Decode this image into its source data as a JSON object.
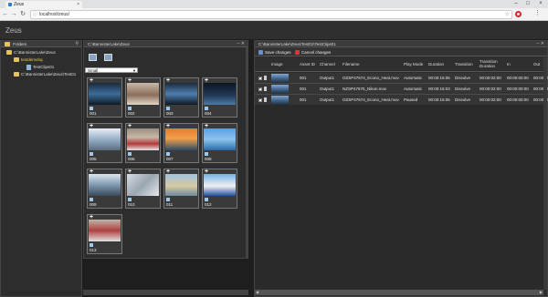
{
  "browser": {
    "tab_title": "Zeus",
    "tab_close": "×",
    "url": "localhost/zeus/",
    "window_minimize": "–",
    "window_maximize": "□",
    "window_close": "×"
  },
  "app": {
    "title": "Zeus"
  },
  "folders_panel": {
    "title": "Folders",
    "tree": [
      {
        "label": "C:\\BannisterLake\\Zeus",
        "type": "folder",
        "level": 1
      },
      {
        "label": "testdemohq",
        "type": "folder",
        "level": 2,
        "selected": true
      },
      {
        "label": "TestClips01",
        "type": "file",
        "level": 3
      },
      {
        "label": "C:\\BannisterLake\\Zeus\\Test01",
        "type": "folder",
        "level": 1
      }
    ]
  },
  "library_panel": {
    "title": "C:\\BannisterLake\\Zeus",
    "size_select": "Small",
    "clips": [
      {
        "num": "001"
      },
      {
        "num": "002"
      },
      {
        "num": "003"
      },
      {
        "num": "004"
      },
      {
        "num": "005"
      },
      {
        "num": "006"
      },
      {
        "num": "007"
      },
      {
        "num": "008"
      },
      {
        "num": "009"
      },
      {
        "num": "010"
      },
      {
        "num": "011"
      },
      {
        "num": "012"
      },
      {
        "num": "013"
      }
    ]
  },
  "clip_panel": {
    "title": "C:\\BannisterLake\\Zeus\\Test01\\TestClips01",
    "save_label": "Save changes",
    "cancel_label": "Cancel changes",
    "columns": [
      "Image",
      "Asset ID",
      "Channel",
      "Filename",
      "Play Mode",
      "Duration",
      "Transition",
      "Transition Duration",
      "In",
      "Out"
    ],
    "rows": [
      {
        "asset": "001",
        "channel": "Output1",
        "filename": "OZSP47674_Econo_Heat.mov",
        "mode": "Automatic",
        "duration": "00:00:15:06",
        "transition": "Dissolve",
        "tduration": "00:00:02:00",
        "in": "00:00:00:00",
        "out": "00:00:15:06"
      },
      {
        "asset": "001",
        "channel": "Output1",
        "filename": "NZSP47675_Nikon.mov",
        "mode": "Automatic",
        "duration": "00:00:15:03",
        "transition": "Dissolve",
        "tduration": "00:00:02:00",
        "in": "00:00:00:00",
        "out": "00:00:15:03"
      },
      {
        "asset": "001",
        "channel": "Output1",
        "filename": "OZSP47674_Econo_Heat.mov",
        "mode": "Paused",
        "duration": "00:00:15:06",
        "transition": "Dissolve",
        "tduration": "00:00:02:00",
        "in": "00:00:00:00",
        "out": "00:00:15:06"
      }
    ]
  },
  "colors": {
    "selected_folder": "#e6d24a",
    "cancel_icon": "#d9343a",
    "save_icon": "#6a8fd0"
  }
}
